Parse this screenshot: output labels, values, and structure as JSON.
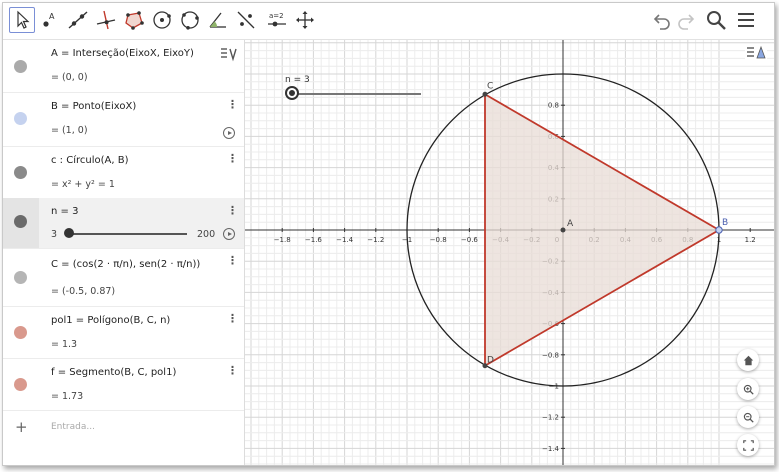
{
  "toolbar": {
    "tools": [
      {
        "name": "move-tool-icon"
      },
      {
        "name": "point-tool-icon"
      },
      {
        "name": "line-tool-icon"
      },
      {
        "name": "perpendicular-line-tool-icon"
      },
      {
        "name": "polygon-tool-icon"
      },
      {
        "name": "circle-center-point-tool-icon"
      },
      {
        "name": "circle-three-points-tool-icon"
      },
      {
        "name": "angle-tool-icon"
      },
      {
        "name": "reflect-tool-icon"
      },
      {
        "name": "slider-tool-icon",
        "label": "a=2"
      },
      {
        "name": "move-graphics-view-tool-icon"
      }
    ],
    "right_icons": [
      "undo-icon",
      "redo-icon",
      "search-icon",
      "menu-icon"
    ]
  },
  "algebra": {
    "rows": [
      {
        "id": "A",
        "color": "#aaaaaa",
        "definition": "A = Interseção(EixoX, EixoY)",
        "value": "= (0, 0)",
        "has_menu": false,
        "has_play": false
      },
      {
        "id": "B",
        "color": "#c5d2ef",
        "definition": "B = Ponto(EixoX)",
        "value": "= (1, 0)",
        "has_menu": true,
        "has_play": true
      },
      {
        "id": "c",
        "color": "#8a8a8a",
        "definition": "c : Círculo(A, B)",
        "value": "= x² + y² = 1",
        "has_menu": true,
        "has_play": false
      },
      {
        "id": "n",
        "color": "#6a6a6a",
        "definition": "n = 3",
        "slider_min": "3",
        "slider_max": "200",
        "slider_value": 3,
        "has_menu": true,
        "has_play": true
      },
      {
        "id": "C",
        "color": "#b5b5b5",
        "definition": "C = (cos(2 · π/n), sen(2 · π/n))",
        "value": "= (-0.5, 0.87)",
        "has_menu": true,
        "has_play": false
      },
      {
        "id": "pol1",
        "color": "#d9998d",
        "definition": "pol1 = Polígono(B, C, n)",
        "value": "= 1.3",
        "has_menu": true,
        "has_play": false
      },
      {
        "id": "f",
        "color": "#d9998d",
        "definition": "f = Segmento(B, C, pol1)",
        "value": "= 1.73",
        "has_menu": true,
        "has_play": false
      }
    ],
    "input_placeholder": "Entrada...",
    "add_symbol": "+"
  },
  "graphics": {
    "slider_label": "n = 3",
    "x_ticks": [
      "−1.8",
      "−1.6",
      "−1.4",
      "−1.2",
      "−1",
      "−0.8",
      "−0.6",
      "−0.4",
      "−0.2",
      "0",
      "0.2",
      "0.4",
      "0.6",
      "0.8",
      "1",
      "1.2"
    ],
    "x_tick_values": [
      -1.8,
      -1.6,
      -1.4,
      -1.2,
      -1,
      -0.8,
      -0.6,
      -0.4,
      -0.2,
      0,
      0.2,
      0.4,
      0.6,
      0.8,
      1,
      1.2
    ],
    "y_ticks": [
      "0.8",
      "0.6",
      "0.4",
      "0.2",
      "−0.2",
      "−0.4",
      "−0.6",
      "−0.8",
      "−1",
      "−1.2",
      "−1.4"
    ],
    "y_tick_values": [
      0.8,
      0.6,
      0.4,
      0.2,
      -0.2,
      -0.4,
      -0.6,
      -0.8,
      -1,
      -1.2,
      -1.4
    ],
    "points": [
      {
        "label": "A",
        "x": 0,
        "y": 0
      },
      {
        "label": "B",
        "x": 1,
        "y": 0
      },
      {
        "label": "C",
        "x": -0.5,
        "y": 0.87
      },
      {
        "label": "D",
        "x": -0.5,
        "y": -0.87
      }
    ],
    "polygon_color": "#c0392b",
    "polygon_fill": "#e8dcd6",
    "circle_color": "#222222"
  }
}
